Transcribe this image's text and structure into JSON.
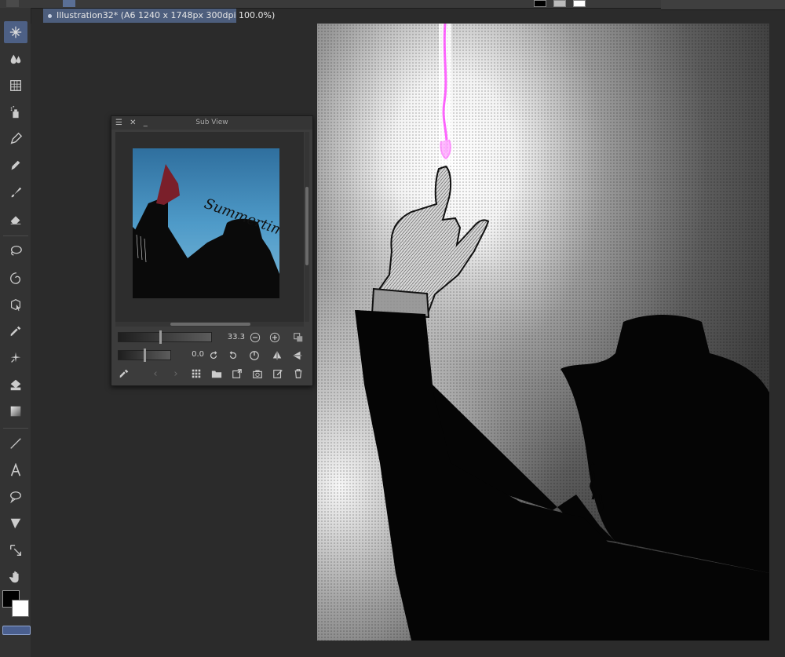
{
  "document_tab": {
    "title": "Illustration32* (A6 1240 x 1748px 300dpi 100.0%)"
  },
  "sub_view": {
    "title": "Sub View",
    "zoom_value": "33.3",
    "rotation_value": "0.0",
    "thumbnail_text": "Summertime"
  },
  "colors": {
    "foreground": "#000000",
    "background": "#ffffff",
    "accent": "#4d6085",
    "highlight": "#ff66ff"
  },
  "toolbar": {
    "tools": [
      "sparkle-icon",
      "droplets-icon",
      "grid-icon",
      "spray-icon",
      "pen-icon",
      "pencil-icon",
      "brush-icon",
      "eraser-icon",
      "lasso-icon",
      "spiral-icon",
      "object-select-icon",
      "eyedropper-icon",
      "auto-select-icon",
      "fill-icon",
      "gradient-icon",
      "line-icon",
      "text-icon",
      "balloon-icon",
      "frame-icon",
      "correct-line-icon",
      "hand-icon"
    ]
  }
}
